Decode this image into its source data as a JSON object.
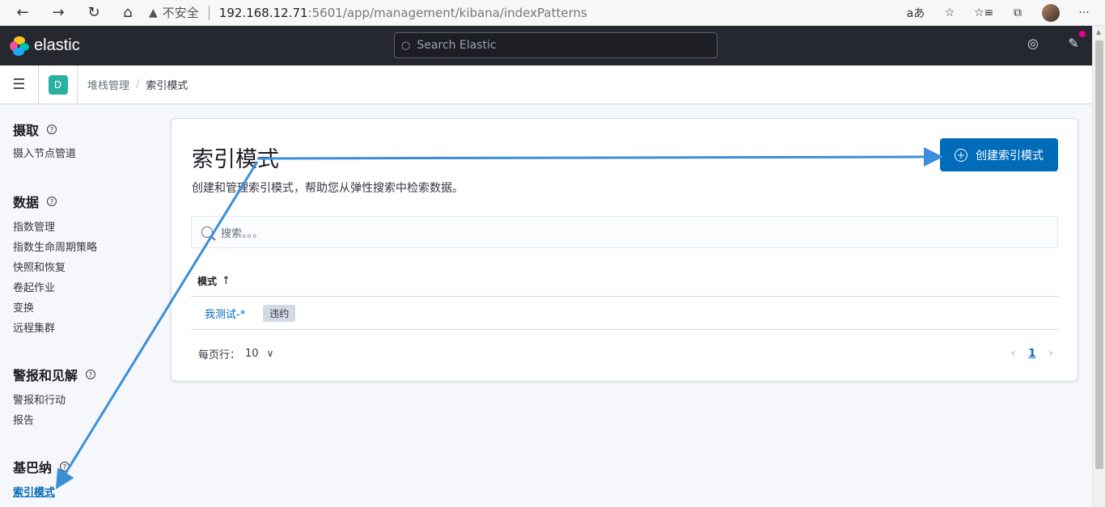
{
  "browser": {
    "security_label": "不安全",
    "url_host": "192.168.12.71",
    "url_rest": ":5601/app/management/kibana/indexPatterns"
  },
  "header": {
    "logo_text": "elastic",
    "search_placeholder": "Search Elastic"
  },
  "breadcrumb": {
    "space_initial": "D",
    "items": [
      "堆栈管理",
      "索引模式"
    ]
  },
  "sidebar": {
    "groups": [
      {
        "title": "摄取",
        "items": [
          "摄入节点管道"
        ]
      },
      {
        "title": "数据",
        "items": [
          "指数管理",
          "指数生命周期策略",
          "快照和恢复",
          "卷起作业",
          "变换",
          "远程集群"
        ]
      },
      {
        "title": "警报和见解",
        "items": [
          "警报和行动",
          "报告"
        ]
      },
      {
        "title": "基巴纳",
        "items": [
          "索引模式"
        ]
      }
    ]
  },
  "main": {
    "title": "索引模式",
    "description": "创建和管理索引模式，帮助您从弹性搜索中检索数据。",
    "create_button": "创建索引模式",
    "search_placeholder": "搜索。。。",
    "column_header": "模式",
    "rows": [
      {
        "pattern": "我测试-*",
        "badge": "违约"
      }
    ],
    "rows_per_page_label": "每页行：",
    "rows_per_page_value": "10",
    "current_page": "1"
  },
  "colors": {
    "primary": "#006bb8",
    "header_bg": "#25282f",
    "annotation_arrow": "#3b8fd9"
  }
}
